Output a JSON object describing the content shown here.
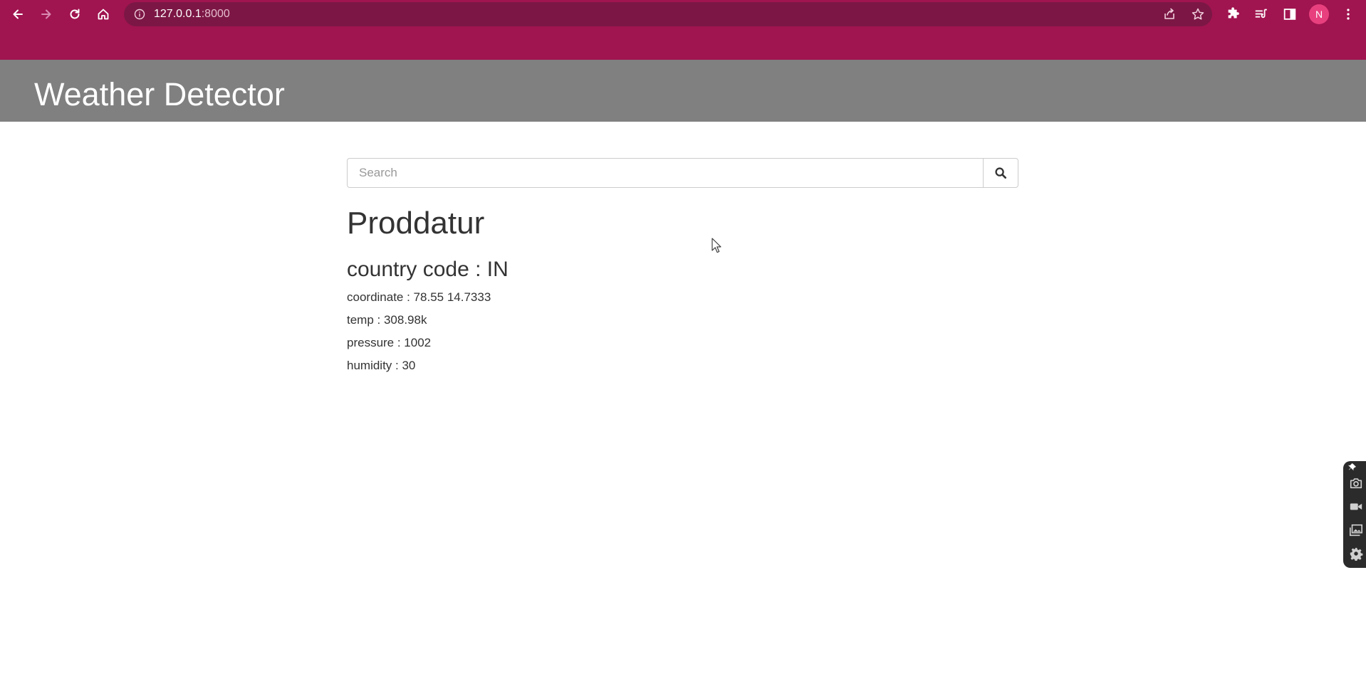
{
  "browser": {
    "url_host": "127.0.0.1",
    "url_port": ":8000",
    "profile_initial": "N",
    "icons": {
      "back": "arrow-left-icon",
      "forward": "arrow-right-icon",
      "reload": "reload-icon",
      "home": "home-icon",
      "site_info": "info-icon",
      "share": "share-icon",
      "bookmark": "star-icon",
      "extensions": "puzzle-icon",
      "media": "playlist-icon",
      "side_panel": "side-panel-icon",
      "menu": "kebab-menu-icon"
    },
    "colors": {
      "frame": "#a0144f",
      "omnibox": "#7c1745",
      "avatar": "#e8407e"
    }
  },
  "header": {
    "title": "Weather Detector",
    "background": "#808080"
  },
  "search": {
    "placeholder": "Search",
    "value": "",
    "button_icon": "search-icon"
  },
  "weather": {
    "city": "Proddatur",
    "country_code": "country code : IN",
    "coordinate": "coordinate : 78.55 14.7333",
    "temp": "temp : 308.98k",
    "pressure": "pressure : 1002",
    "humidity": "humidity : 30"
  },
  "capture_widget": {
    "icons": [
      "pin-icon",
      "camera-icon",
      "video-icon",
      "gallery-icon",
      "gear-icon"
    ]
  }
}
